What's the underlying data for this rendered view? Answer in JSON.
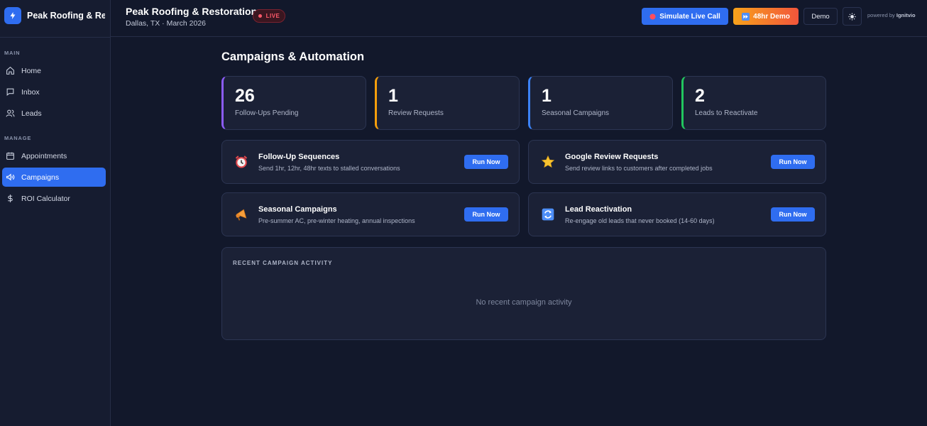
{
  "sidebar": {
    "brand": "Peak Roofing & Restoration",
    "sections": [
      "MAIN",
      "MANAGE"
    ],
    "items": [
      {
        "label": "Home",
        "icon": "home-icon"
      },
      {
        "label": "Inbox",
        "icon": "inbox-icon"
      },
      {
        "label": "Leads",
        "icon": "users-icon"
      },
      {
        "label": "Appointments",
        "icon": "calendar-icon"
      },
      {
        "label": "Campaigns",
        "icon": "megaphone-icon",
        "active": true
      },
      {
        "label": "ROI Calculator",
        "icon": "dollar-icon"
      }
    ]
  },
  "header": {
    "title": "Peak Roofing & Restoration",
    "subtitle": "Dallas, TX · March 2026",
    "live_label": "LIVE",
    "simulate_label": "Simulate Live Call",
    "demo48_label": "48hr Demo",
    "demo_label": "Demo",
    "theme_icon": "sun-icon",
    "powered_by": "powered by",
    "powered_brand": "Ignitvio"
  },
  "main": {
    "title": "Campaigns & Automation",
    "stats": [
      {
        "value": "26",
        "label": "Follow-Ups Pending",
        "color": "#8b5cf6"
      },
      {
        "value": "1",
        "label": "Review Requests",
        "color": "#f59e0b"
      },
      {
        "value": "1",
        "label": "Seasonal Campaigns",
        "color": "#3b82f6"
      },
      {
        "value": "2",
        "label": "Leads to Reactivate",
        "color": "#22c55e"
      }
    ],
    "automations": [
      {
        "title": "Follow-Up Sequences",
        "desc": "Send 1hr, 12hr, 48hr texts to stalled conversations",
        "icon": "alarm-clock-icon",
        "button": "Run Now"
      },
      {
        "title": "Google Review Requests",
        "desc": "Send review links to customers after completed jobs",
        "icon": "star-icon",
        "button": "Run Now"
      },
      {
        "title": "Seasonal Campaigns",
        "desc": "Pre-summer AC, pre-winter heating, annual inspections",
        "icon": "megaphone-icon",
        "button": "Run Now"
      },
      {
        "title": "Lead Reactivation",
        "desc": "Re-engage old leads that never booked (14-60 days)",
        "icon": "refresh-icon",
        "button": "Run Now"
      }
    ],
    "activity": {
      "heading": "RECENT CAMPAIGN ACTIVITY",
      "empty": "No recent campaign activity"
    }
  },
  "colors": {
    "accent": "#2f6df0",
    "background": "#12182b",
    "live": "#ff5a6a"
  }
}
